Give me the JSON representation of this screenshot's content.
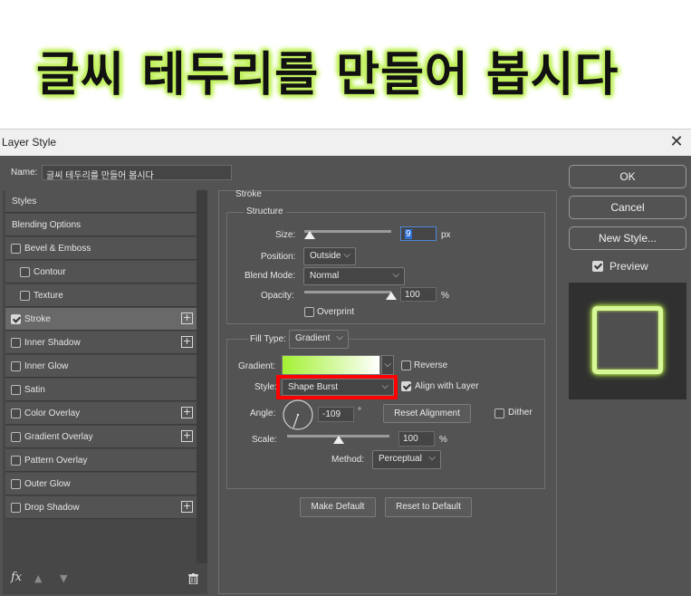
{
  "banner": {
    "text": "글씨 테두리를 만들어 봅시다"
  },
  "window": {
    "title": "Layer Style",
    "close_glyph": "✕"
  },
  "name_field": {
    "label": "Name:",
    "value": "글씨 테두리를 만들어 봅시다"
  },
  "styles_panel": {
    "items": [
      {
        "label": "Styles",
        "checkbox": false,
        "checked": false,
        "plus": false
      },
      {
        "label": "Blending Options",
        "checkbox": false,
        "checked": false,
        "plus": false
      },
      {
        "label": "Bevel & Emboss",
        "checkbox": true,
        "checked": false,
        "plus": false
      },
      {
        "label": "Contour",
        "checkbox": true,
        "checked": false,
        "plus": false
      },
      {
        "label": "Texture",
        "checkbox": true,
        "checked": false,
        "plus": false
      },
      {
        "label": "Stroke",
        "checkbox": true,
        "checked": true,
        "plus": true
      },
      {
        "label": "Inner Shadow",
        "checkbox": true,
        "checked": false,
        "plus": true
      },
      {
        "label": "Inner Glow",
        "checkbox": true,
        "checked": false,
        "plus": false
      },
      {
        "label": "Satin",
        "checkbox": true,
        "checked": false,
        "plus": false
      },
      {
        "label": "Color Overlay",
        "checkbox": true,
        "checked": false,
        "plus": true
      },
      {
        "label": "Gradient Overlay",
        "checkbox": true,
        "checked": false,
        "plus": true
      },
      {
        "label": "Pattern Overlay",
        "checkbox": true,
        "checked": false,
        "plus": false
      },
      {
        "label": "Outer Glow",
        "checkbox": true,
        "checked": false,
        "plus": false
      },
      {
        "label": "Drop Shadow",
        "checkbox": true,
        "checked": false,
        "plus": true
      }
    ],
    "footer": {
      "fx": "fx"
    }
  },
  "stroke": {
    "section_title": "Stroke",
    "structure_title": "Structure",
    "size_label": "Size:",
    "size_value": "9",
    "size_unit": "px",
    "size_fraction": 0.06,
    "position_label": "Position:",
    "position_value": "Outside",
    "blend_label": "Blend Mode:",
    "blend_value": "Normal",
    "opacity_label": "Opacity:",
    "opacity_value": "100",
    "opacity_unit": "%",
    "opacity_fraction": 1.0,
    "overprint_label": "Overprint",
    "filltype_label": "Fill Type:",
    "filltype_value": "Gradient",
    "gradient_label": "Gradient:",
    "reverse_label": "Reverse",
    "style_label": "Style:",
    "style_value": "Shape Burst",
    "align_label": "Align with Layer",
    "angle_label": "Angle:",
    "angle_value": "-109",
    "angle_unit": "°",
    "reset_alignment_label": "Reset Alignment",
    "dither_label": "Dither",
    "scale_label": "Scale:",
    "scale_value": "100",
    "scale_unit": "%",
    "scale_fraction": 0.5,
    "method_label": "Method:",
    "method_value": "Perceptual",
    "make_default_label": "Make Default",
    "reset_default_label": "Reset to Default"
  },
  "right_panel": {
    "ok_label": "OK",
    "cancel_label": "Cancel",
    "new_style_label": "New Style...",
    "preview_label": "Preview"
  },
  "colors": {
    "highlight_red": "#ff0000",
    "gradient_start": "#a4f134",
    "gradient_end": "#ffffff",
    "glow": "#c8f36a"
  }
}
